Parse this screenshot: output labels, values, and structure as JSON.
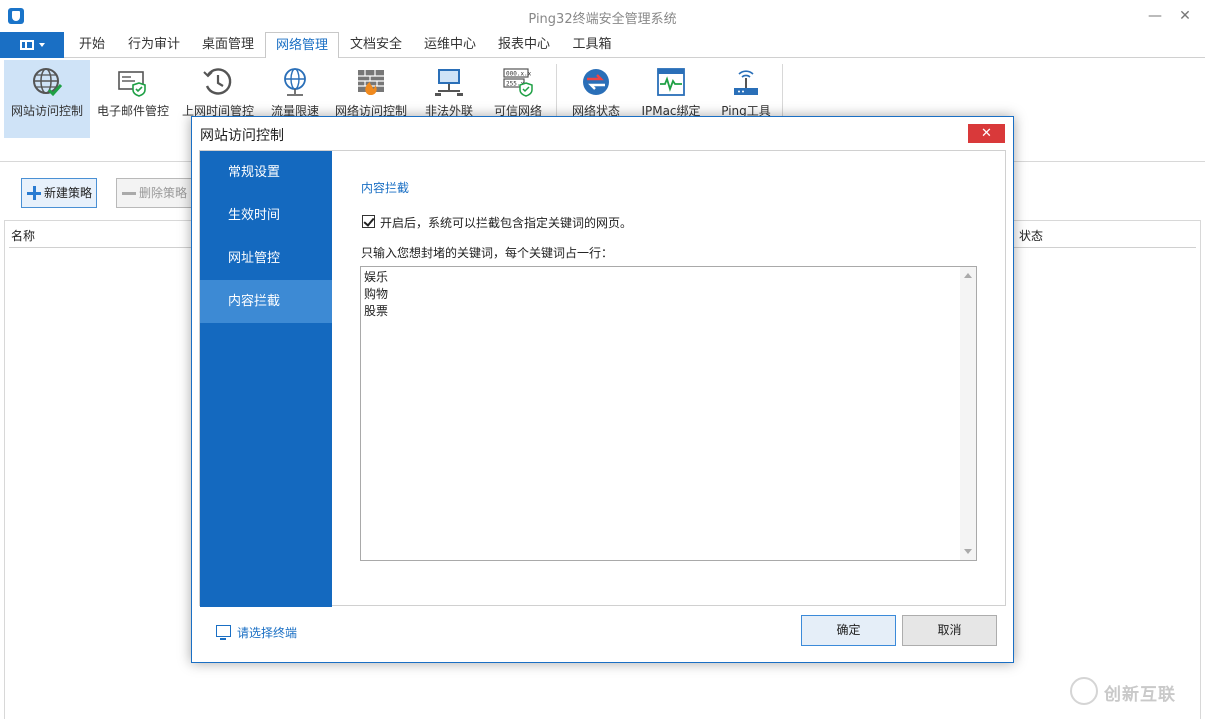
{
  "window": {
    "title": "Ping32终端安全管理系统",
    "minimize": "—",
    "maximize": "☐",
    "close": "✕"
  },
  "menu": {
    "tabs": [
      {
        "label": "开始"
      },
      {
        "label": "行为审计"
      },
      {
        "label": "桌面管理"
      },
      {
        "label": "网络管理",
        "active": true
      },
      {
        "label": "文档安全"
      },
      {
        "label": "运维中心"
      },
      {
        "label": "报表中心"
      },
      {
        "label": "工具箱"
      }
    ]
  },
  "ribbon": {
    "items": [
      {
        "label": "网站访问控制",
        "icon": "globe-check-icon",
        "active": true
      },
      {
        "label": "电子邮件管控",
        "icon": "mail-shield-icon"
      },
      {
        "label": "上网时间管控",
        "icon": "clock-history-icon"
      },
      {
        "label": "流量限速",
        "icon": "globe-network-icon"
      },
      {
        "label": "网络访问控制",
        "icon": "firewall-icon"
      },
      {
        "label": "非法外联",
        "icon": "network-computer-icon"
      },
      {
        "label": "可信网络",
        "icon": "ip-shield-icon"
      },
      {
        "label": "网络状态",
        "icon": "network-status-icon"
      },
      {
        "label": "IPMac绑定",
        "icon": "ipmac-bind-icon"
      },
      {
        "label": "Ping工具",
        "icon": "ping-router-icon"
      }
    ]
  },
  "toolbar": {
    "new_policy": "新建策略",
    "delete_policy": "删除策略"
  },
  "grid": {
    "col_name": "名称",
    "col_status": "状态"
  },
  "dialog": {
    "title": "网站访问控制",
    "close": "✕",
    "nav": [
      {
        "label": "常规设置"
      },
      {
        "label": "生效时间"
      },
      {
        "label": "网址管控"
      },
      {
        "label": "内容拦截",
        "active": true
      }
    ],
    "section_title": "内容拦截",
    "checkbox_label": "开启后，系统可以拦截包含指定关键词的网页。",
    "checkbox_checked": true,
    "hint": "只输入您想封堵的关键词，每个关键词占一行：",
    "keywords": [
      "娱乐",
      "购物",
      "股票"
    ],
    "select_terminal": "请选择终端",
    "ok": "确定",
    "cancel": "取消"
  },
  "watermark": {
    "text": "创新互联"
  },
  "colors": {
    "accent": "#1a6fc4",
    "nav_bg": "#1469bf",
    "nav_active": "#3d8ad4",
    "close_red": "#d9393a"
  }
}
